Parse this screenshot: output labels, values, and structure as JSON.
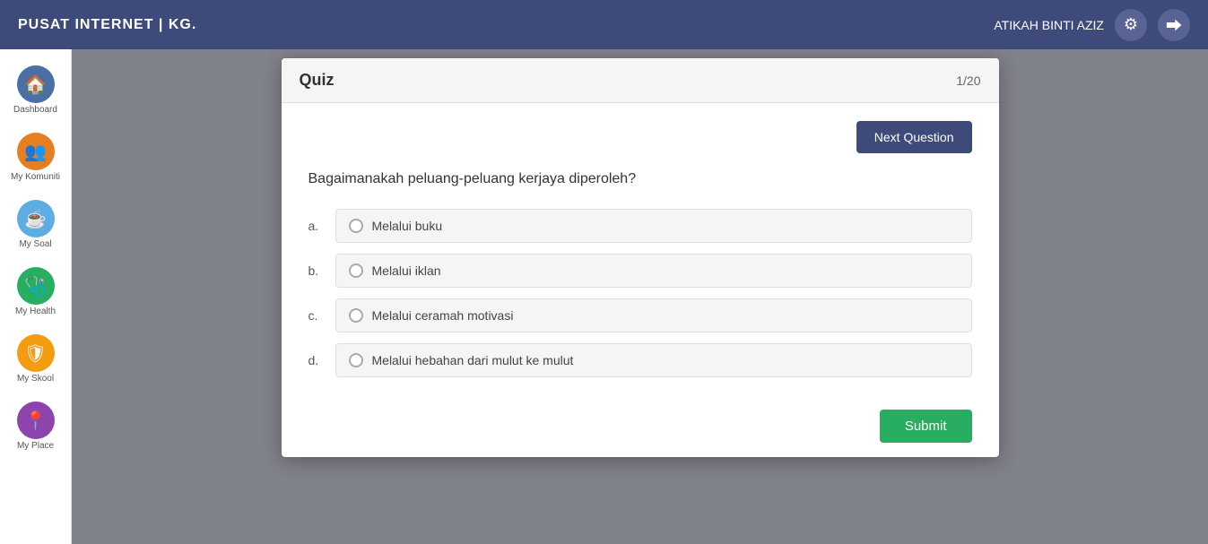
{
  "topbar": {
    "title": "PUSAT INTERNET | KG.",
    "username": "ATIKAH BINTI AZIZ",
    "gear_icon": "⚙",
    "logout_icon": "⮕"
  },
  "sidebar": {
    "items": [
      {
        "id": "dashboard",
        "label": "Dashboard",
        "icon": "🏠",
        "color_class": "icon-dashboard"
      },
      {
        "id": "komuniti",
        "label": "My Komuniti",
        "icon": "👥",
        "color_class": "icon-komuniti"
      },
      {
        "id": "soal",
        "label": "My Soal",
        "icon": "☕",
        "color_class": "icon-soal"
      },
      {
        "id": "health",
        "label": "My Health",
        "icon": "🩺",
        "color_class": "icon-health"
      },
      {
        "id": "skool",
        "label": "My Skool",
        "icon": "🛡",
        "color_class": "icon-skool"
      },
      {
        "id": "place",
        "label": "My Place",
        "icon": "📍",
        "color_class": "icon-place"
      }
    ]
  },
  "modal": {
    "title": "Quiz",
    "counter": "1/20",
    "next_question_label": "Next Question",
    "question": "Bagaimanakah peluang-peluang kerjaya diperoleh?",
    "options": [
      {
        "key": "a",
        "text": "Melalui buku"
      },
      {
        "key": "b",
        "text": "Melalui iklan"
      },
      {
        "key": "c",
        "text": "Melalui ceramah motivasi"
      },
      {
        "key": "d",
        "text": "Melalui hebahan dari mulut ke mulut"
      }
    ],
    "submit_label": "Submit"
  }
}
